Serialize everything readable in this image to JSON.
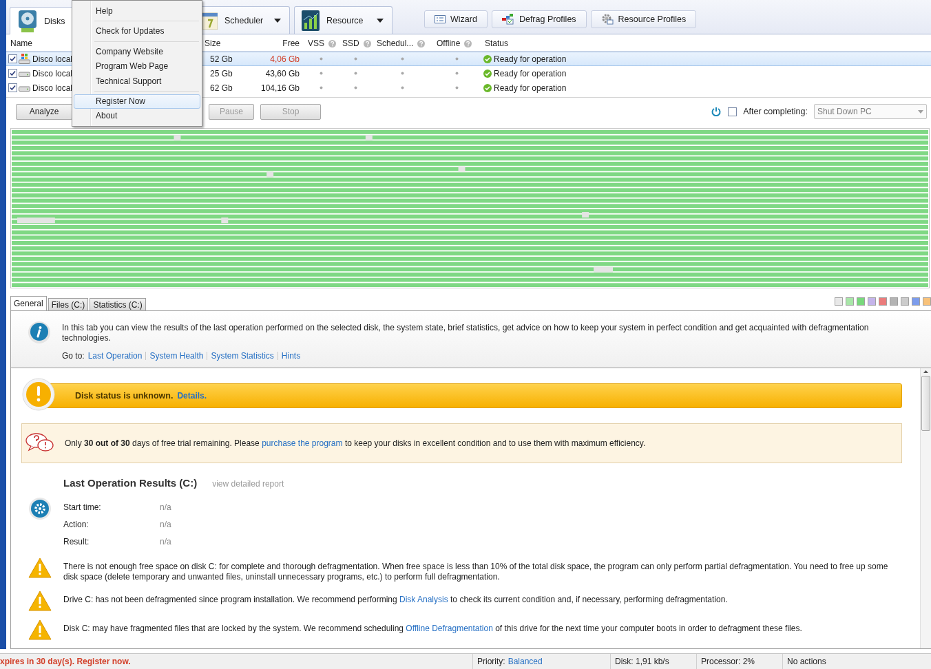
{
  "toolbar": {
    "tabs": [
      {
        "label": "Disks",
        "kind": "disks",
        "selected": true
      },
      {
        "label": "Scheduler",
        "kind": "scheduler",
        "selected": false,
        "dropdown": true
      },
      {
        "label": "Resource",
        "kind": "resource",
        "selected": false,
        "dropdown": true
      }
    ],
    "buttons": [
      {
        "label": "Wizard",
        "kind": "wizard"
      },
      {
        "label": "Defrag Profiles",
        "kind": "defrag"
      },
      {
        "label": "Resource Profiles",
        "kind": "gear"
      }
    ]
  },
  "menu": {
    "groups": [
      [
        {
          "label": "Help",
          "highlighted": false
        }
      ],
      [
        {
          "label": "Check for Updates",
          "highlighted": false
        }
      ],
      [
        {
          "label": "Company Website",
          "highlighted": false
        },
        {
          "label": "Program Web Page",
          "highlighted": false
        },
        {
          "label": "Technical Support",
          "highlighted": false
        }
      ],
      [
        {
          "label": "Register Now",
          "highlighted": true
        },
        {
          "label": "About",
          "highlighted": false
        }
      ]
    ]
  },
  "disks": {
    "columns": {
      "name": "Name",
      "size": "Size",
      "free": "Free",
      "vss": "VSS",
      "ssd": "SSD",
      "scheduled": "Schedul...",
      "offline": "Offline",
      "status": "Status"
    },
    "rows": [
      {
        "name": "Disco local",
        "kind": "system",
        "checked": true,
        "selected": true,
        "size": "52 Gb",
        "free": "4,06 Gb",
        "low": true,
        "status": "Ready for operation"
      },
      {
        "name": "Disco local",
        "kind": "drive",
        "checked": true,
        "selected": false,
        "size": "25 Gb",
        "free": "43,60 Gb",
        "low": false,
        "status": "Ready for operation"
      },
      {
        "name": "Disco local",
        "kind": "drive",
        "checked": true,
        "selected": false,
        "size": "62 Gb",
        "free": "104,16 Gb",
        "low": false,
        "status": "Ready for operation"
      }
    ]
  },
  "actions": {
    "buttons": [
      {
        "label": "Analyze",
        "disabled": false
      },
      {
        "label": "Pause",
        "disabled": true
      },
      {
        "label": "Stop",
        "disabled": true
      }
    ],
    "after_completing": {
      "label": "After completing:",
      "checked": false,
      "value": "Shut Down PC",
      "disabled": true
    }
  },
  "legend": [
    {
      "color": "#e8e8e8"
    },
    {
      "color": "#a8e6a8"
    },
    {
      "color": "#78d87c"
    },
    {
      "color": "#c4b4ea"
    },
    {
      "color": "#ea7c7c"
    },
    {
      "color": "#b4b4b4"
    },
    {
      "color": "#cccccc"
    },
    {
      "color": "#7c9cec"
    },
    {
      "color": "#f8c27a"
    }
  ],
  "tabs": [
    {
      "label": "General",
      "selected": true
    },
    {
      "label": "Files (C:)",
      "selected": false
    },
    {
      "label": "Statistics (C:)",
      "selected": false
    }
  ],
  "info": {
    "text": "In this tab you can view the results of the last operation performed on the selected disk, the system state, brief statistics, get advice on how to keep your system in perfect condition and get acquainted with defragmentation technologies.",
    "goto_label": "Go to:",
    "links": [
      "Last Operation",
      "System Health",
      "System Statistics",
      "Hints"
    ]
  },
  "banner": {
    "text": "Disk status is unknown.",
    "link": "Details."
  },
  "trial": [
    {
      "kind": "text",
      "text": "Only "
    },
    {
      "kind": "bold",
      "text": "30 out of 30"
    },
    {
      "kind": "text",
      "text": " days of free trial remaining. Please "
    },
    {
      "kind": "link",
      "text": "purchase the program"
    },
    {
      "kind": "text",
      "text": " to keep your disks in excellent condition and to use them with maximum efficiency."
    }
  ],
  "last_operation": {
    "title": "Last Operation Results (C:)",
    "report_link": "view detailed report",
    "fields": [
      {
        "label": "Start time:",
        "value": "n/a"
      },
      {
        "label": "Action:",
        "value": "n/a"
      },
      {
        "label": "Result:",
        "value": "n/a"
      }
    ]
  },
  "hints": [
    [
      {
        "kind": "text",
        "text": "There is not enough free space on disk C: for complete and thorough defragmentation. When free space is less than 10% of the total disk space, the program can only perform partial defragmentation. You need to free up some disk space (delete temporary and unwanted files, uninstall unnecessary programs, etc.) to perform full defragmentation."
      }
    ],
    [
      {
        "kind": "text",
        "text": "Drive C: has not been defragmented since program installation. We recommend performing "
      },
      {
        "kind": "link",
        "text": "Disk Analysis"
      },
      {
        "kind": "text",
        "text": " to check its current condition and, if necessary, performing defragmentation."
      }
    ],
    [
      {
        "kind": "text",
        "text": "Disk C: may have fragmented files that are locked by the system. We recommend scheduling "
      },
      {
        "kind": "link",
        "text": "Offline Defragmentation"
      },
      {
        "kind": "text",
        "text": " of this drive for the next time your computer boots in order to defragment these files."
      }
    ]
  ],
  "status_bar": {
    "message": "xpires in 30 day(s). Register now.",
    "priority_label": "Priority:",
    "priority": "Balanced",
    "disk": "Disk: 1,91 kb/s",
    "processor": "Processor: 2%",
    "actions": "No actions"
  }
}
